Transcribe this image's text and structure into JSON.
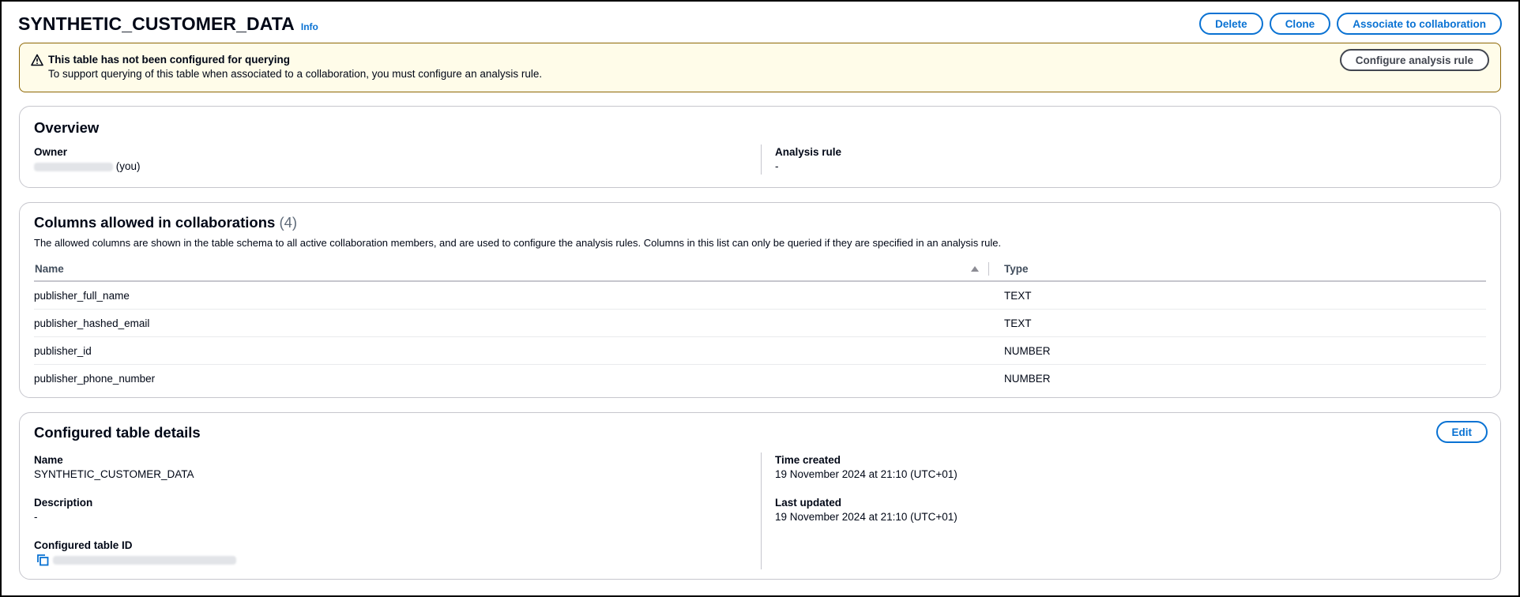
{
  "header": {
    "title": "SYNTHETIC_CUSTOMER_DATA",
    "info_label": "Info",
    "delete_label": "Delete",
    "clone_label": "Clone",
    "associate_label": "Associate to collaboration"
  },
  "alert": {
    "icon": "warning-icon",
    "title": "This table has not been configured for querying",
    "message": "To support querying of this table when associated to a collaboration, you must configure an analysis rule.",
    "button_label": "Configure analysis rule"
  },
  "overview": {
    "title": "Overview",
    "owner_label": "Owner",
    "owner_suffix": "(you)",
    "analysis_rule_label": "Analysis rule",
    "analysis_rule_value": "-"
  },
  "columns": {
    "title": "Columns allowed in collaborations",
    "count": "(4)",
    "description": "The allowed columns are shown in the table schema to all active collaboration members, and are used to configure the analysis rules. Columns in this list can only be queried if they are specified in an analysis rule.",
    "headers": {
      "name": "Name",
      "type": "Type"
    },
    "rows": [
      {
        "name": "publisher_full_name",
        "type": "TEXT"
      },
      {
        "name": "publisher_hashed_email",
        "type": "TEXT"
      },
      {
        "name": "publisher_id",
        "type": "NUMBER"
      },
      {
        "name": "publisher_phone_number",
        "type": "NUMBER"
      }
    ]
  },
  "details": {
    "title": "Configured table details",
    "edit_label": "Edit",
    "name_label": "Name",
    "name_value": "SYNTHETIC_CUSTOMER_DATA",
    "description_label": "Description",
    "description_value": "-",
    "table_id_label": "Configured table ID",
    "time_created_label": "Time created",
    "time_created_value": "19 November 2024 at 21:10 (UTC+01)",
    "last_updated_label": "Last updated",
    "last_updated_value": "19 November 2024 at 21:10 (UTC+01)"
  },
  "colors": {
    "link": "#0972d3",
    "warning_border": "#8d6605",
    "warning_bg": "#fffce9",
    "text": "#000716"
  }
}
